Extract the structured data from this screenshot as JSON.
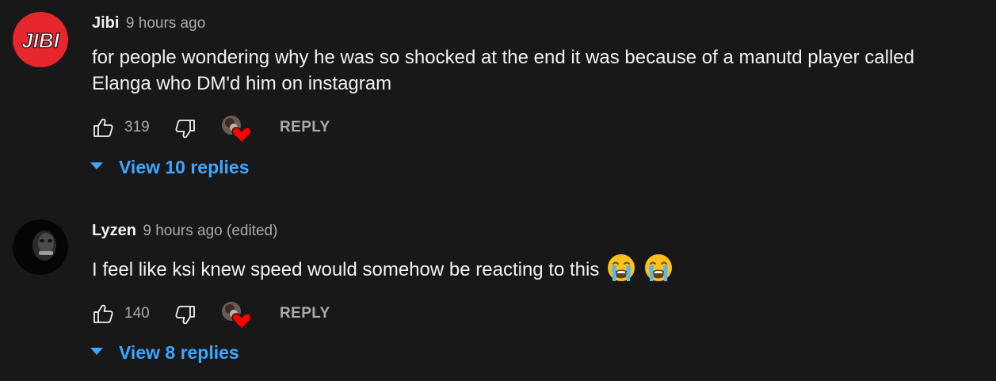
{
  "comments": [
    {
      "author": "Jibi",
      "time": "9 hours ago",
      "text": "for people wondering why he was so shocked at the end it was because of a manutd player called Elanga who DM'd him on instagram",
      "avatar_logo_text": "JIBI",
      "likes": "319",
      "reply_label": "REPLY",
      "replies_label": "View 10 replies"
    },
    {
      "author": "Lyzen",
      "time": "9 hours ago (edited)",
      "text": "I feel like ksi knew speed would somehow be reacting to this",
      "emojis": [
        "loudly-crying-face",
        "loudly-crying-face"
      ],
      "likes": "140",
      "reply_label": "REPLY",
      "replies_label": "View 8 replies"
    }
  ],
  "icons": {
    "like": "thumbs-up-icon",
    "dislike": "thumbs-down-icon",
    "creator_heart": "creator-heart-icon",
    "expand": "caret-down-icon"
  },
  "colors": {
    "background": "#181818",
    "text_primary": "#f1f1f1",
    "text_secondary": "#aaaaaa",
    "link_blue": "#3ea6ff",
    "jibi_avatar_red": "#e8262d",
    "heart_red": "#ff0000"
  }
}
